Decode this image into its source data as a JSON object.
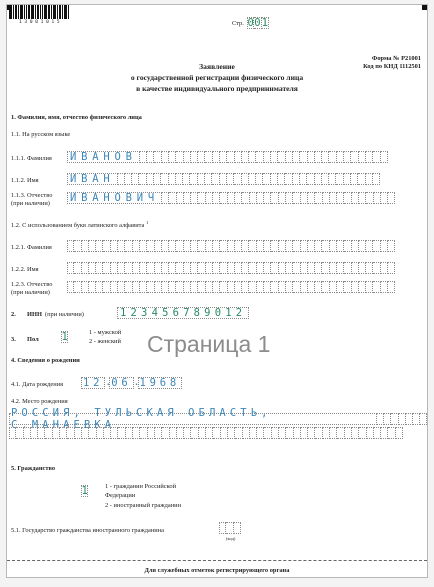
{
  "barcode_number": "1 3 0 0 1 0 1 5",
  "page": {
    "label": "Стр.",
    "digits": [
      "0",
      "0",
      "1"
    ]
  },
  "form_no": "Форма № Р21001",
  "knd": "Код по КНД 1112501",
  "title": [
    "Заявление",
    "о государственной регистрации физического лица",
    "в качестве индивидуального предпринимателя"
  ],
  "watermark": "Страница 1",
  "s1": {
    "title": "1.   Фамилия, имя, отчество физического лица",
    "sub_ru": "1.1. На русском языке",
    "sub_lat": "1.2. С использованием букв латинского алфавита",
    "sup": "1",
    "f111": "1.1.1. Фамилия",
    "f112": "1.1.2. Имя",
    "f113": "1.1.3. Отчество",
    "if_any": "(при наличии)",
    "f121": "1.2.1. Фамилия",
    "f122": "1.2.2. Имя",
    "f123": "1.2.3. Отчество",
    "surname": "ИВАНОВ",
    "name": "ИВАН",
    "patronymic": "ИВАНОВИЧ"
  },
  "s2": {
    "num": "2.",
    "label": "ИНН",
    "if_any": "(при наличии)",
    "inn": "123456789012"
  },
  "s3": {
    "num": "3.",
    "label": "Пол",
    "value": "1",
    "opt1": "1 - мужской",
    "opt2": "2 - женский"
  },
  "s4": {
    "title": "4.   Сведения о рождении",
    "date_label": "4.1. Дата рождения",
    "day": "12",
    "month": "06",
    "year": "1968",
    "place_label": "4.2. Место рождения",
    "place": "РОССИЯ, ТУЛЬСКАЯ ОБЛАСТЬ, С.МАНАЕВКА"
  },
  "s5": {
    "title": "5.   Гражданство",
    "value": "1",
    "opt1a": "1 - гражданин Российской",
    "opt1b": "Федерации",
    "opt2": "2 - иностранный гражданин",
    "state_label": "5.1. Государство гражданства иностранного гражданина",
    "code_label": "(код)"
  },
  "footer": "Для служебных отметок регистрирующего органа",
  "colors": {
    "filled": "#3d86b8",
    "green": "#2a8a62"
  }
}
